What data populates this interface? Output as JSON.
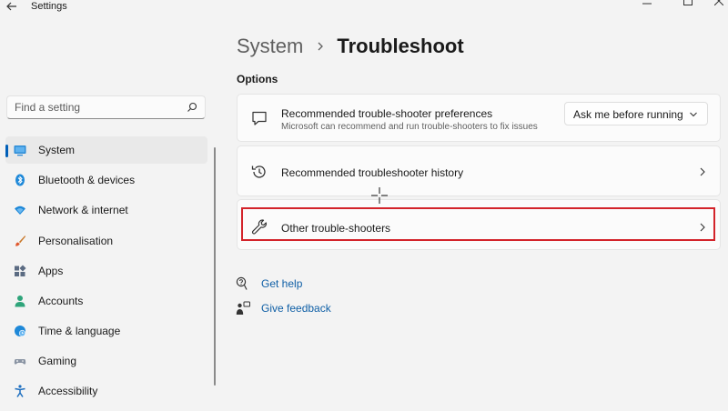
{
  "window": {
    "title": "Settings"
  },
  "search": {
    "placeholder": "Find a setting"
  },
  "sidebar": {
    "items": [
      {
        "label": "System",
        "icon": "display-icon",
        "active": true
      },
      {
        "label": "Bluetooth & devices",
        "icon": "bluetooth-icon"
      },
      {
        "label": "Network & internet",
        "icon": "wifi-icon"
      },
      {
        "label": "Personalisation",
        "icon": "brush-icon"
      },
      {
        "label": "Apps",
        "icon": "apps-icon"
      },
      {
        "label": "Accounts",
        "icon": "person-icon"
      },
      {
        "label": "Time & language",
        "icon": "clock-globe-icon"
      },
      {
        "label": "Gaming",
        "icon": "gamepad-icon"
      },
      {
        "label": "Accessibility",
        "icon": "accessibility-icon"
      }
    ]
  },
  "breadcrumb": {
    "parent": "System",
    "current": "Troubleshoot"
  },
  "options": {
    "heading": "Options",
    "preferences": {
      "title": "Recommended trouble-shooter preferences",
      "subtitle": "Microsoft can recommend and run trouble-shooters to fix issues",
      "dropdown_value": "Ask me before running"
    },
    "history": {
      "title": "Recommended troubleshooter history"
    },
    "other": {
      "title": "Other trouble-shooters"
    }
  },
  "links": {
    "help": "Get help",
    "feedback": "Give feedback"
  },
  "colors": {
    "accent": "#005fb8",
    "link": "#0f5fa6",
    "highlight": "#d3232a",
    "background": "#f3f3f3"
  }
}
